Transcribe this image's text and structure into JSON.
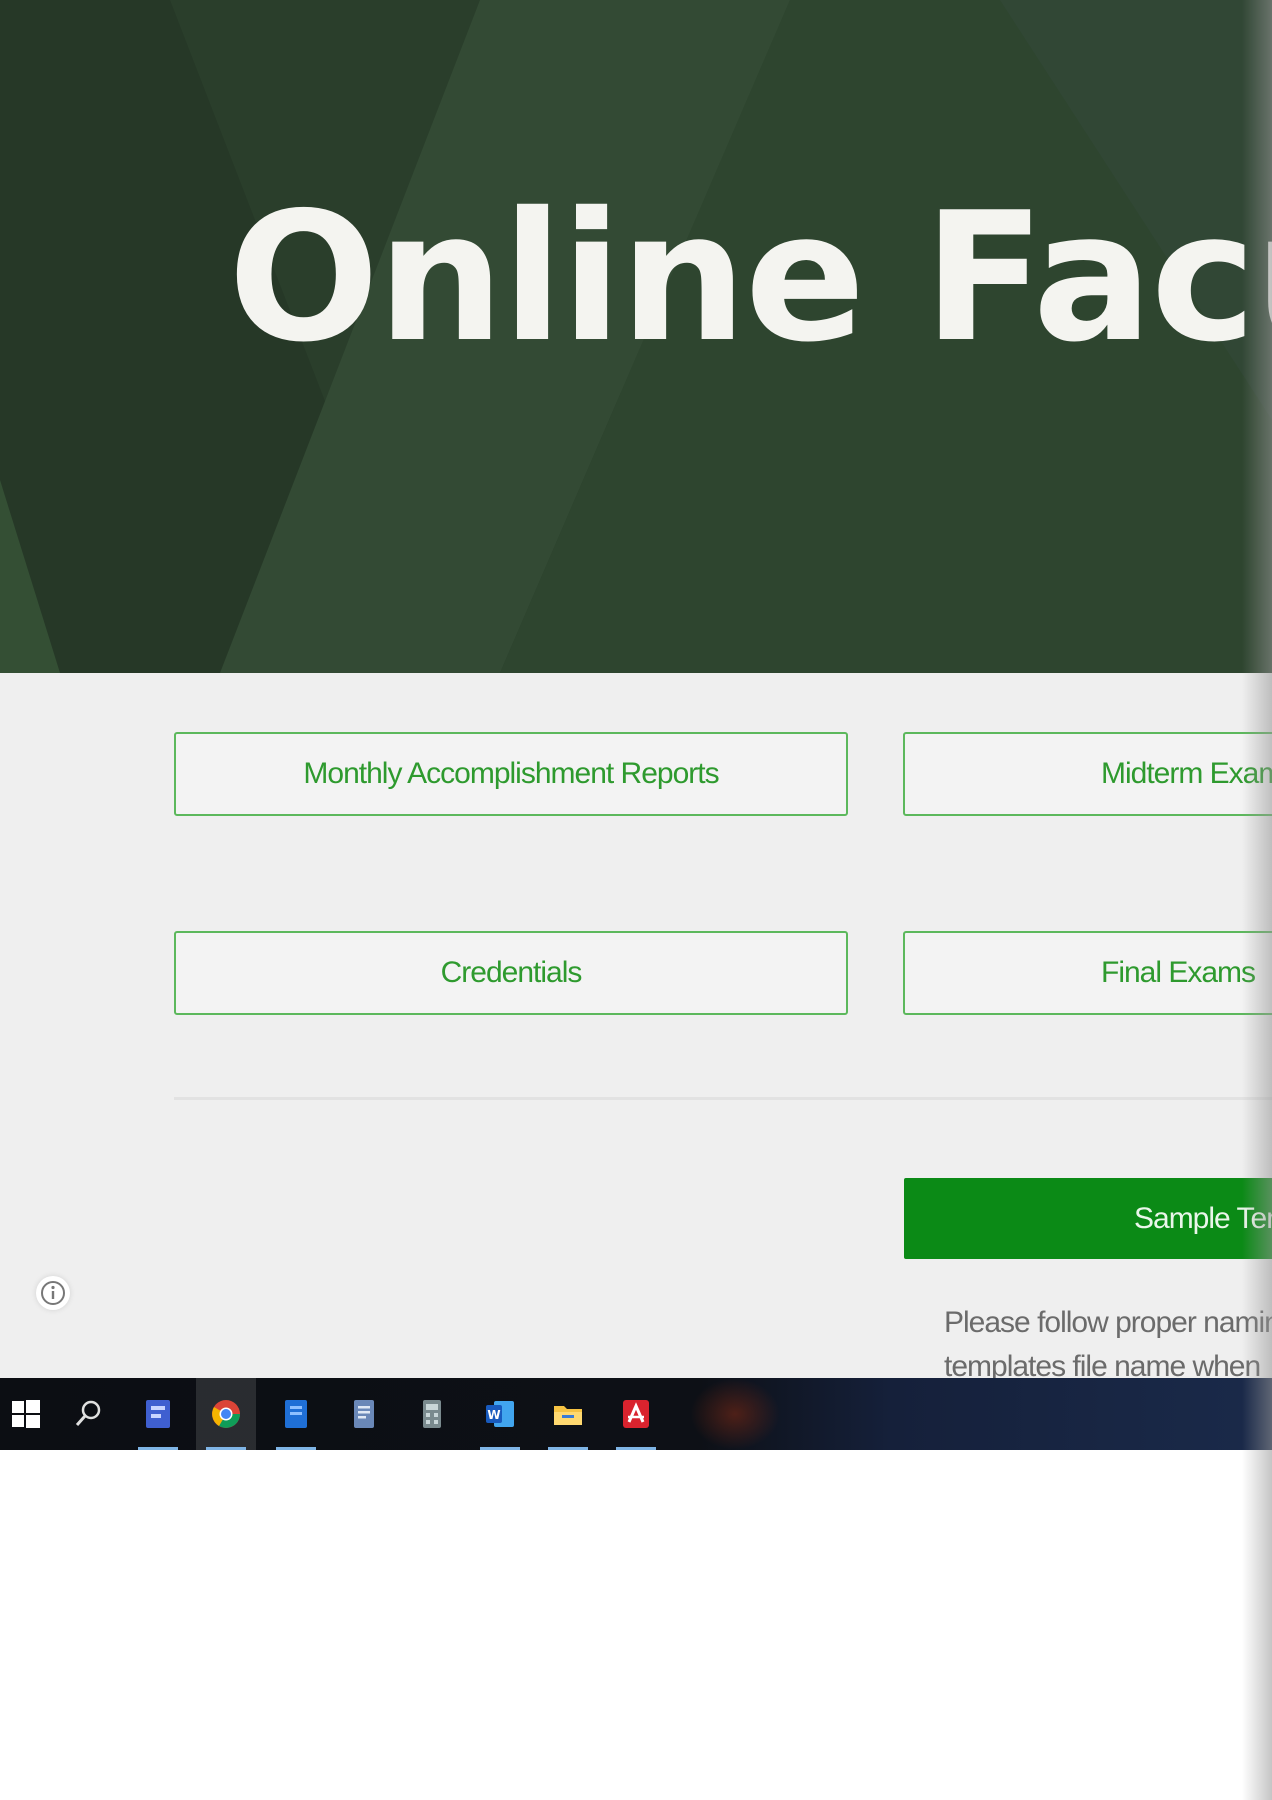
{
  "hero": {
    "title": "Online Faculty"
  },
  "nav_buttons": [
    {
      "label": "Monthly Accomplishment Reports"
    },
    {
      "label": "Midterm Exam"
    },
    {
      "label": "Credentials"
    },
    {
      "label": "Final Exams"
    }
  ],
  "primary_button": {
    "label": "Sample Tem"
  },
  "note": {
    "line1": "Please follow proper naming",
    "line2": "templates file name when"
  },
  "colors": {
    "hero_bg": "#2f4530",
    "accent_green": "#5cb85c",
    "button_green": "#0b8a16"
  },
  "taskbar": {
    "items": [
      {
        "icon": "windows-start-icon"
      },
      {
        "icon": "search-icon"
      },
      {
        "icon": "app-icon"
      },
      {
        "icon": "chrome-icon"
      },
      {
        "icon": "app-icon"
      },
      {
        "icon": "document-icon"
      },
      {
        "icon": "calculator-icon"
      },
      {
        "icon": "word-icon"
      },
      {
        "icon": "file-explorer-icon"
      },
      {
        "icon": "acrobat-icon"
      }
    ]
  }
}
